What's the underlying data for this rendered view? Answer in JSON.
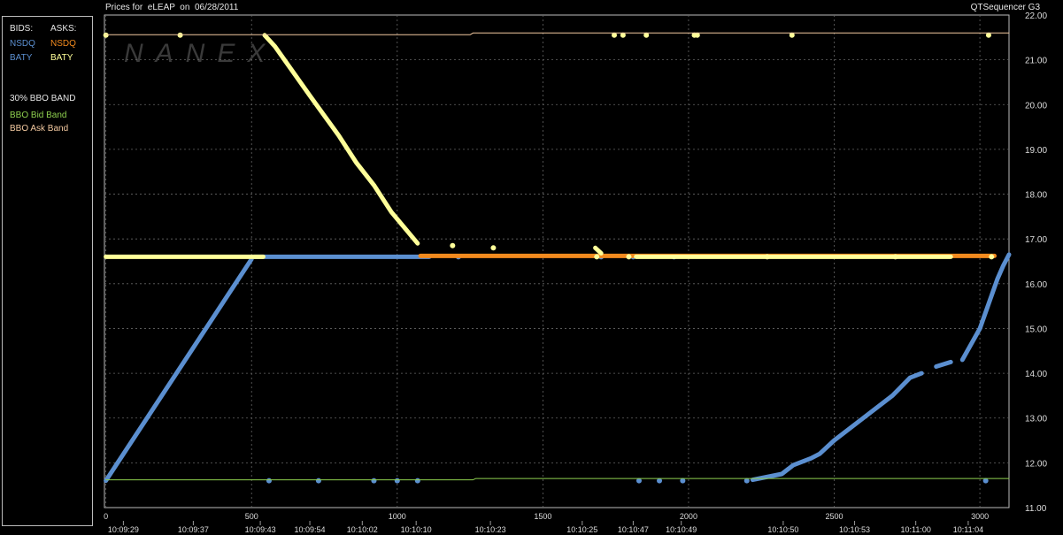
{
  "header": {
    "title": "Prices for  eLEAP  on  06/28/2011",
    "app_name": "QTSequencer G3"
  },
  "legend": {
    "bids_label": "BIDS:",
    "asks_label": "ASKS:",
    "bid_exchanges": [
      {
        "label": "NSDQ",
        "color": "#5b8fd0"
      },
      {
        "label": "BATY",
        "color": "#5b8fd0"
      }
    ],
    "ask_exchanges": [
      {
        "label": "NSDQ",
        "color": "#f28a1e"
      },
      {
        "label": "BATY",
        "color": "#ffff99"
      }
    ],
    "band_title": "30% BBO BAND",
    "bid_band": {
      "label": "BBO Bid Band",
      "color": "#8fd14f"
    },
    "ask_band": {
      "label": "BBO Ask Band",
      "color": "#f3c9a0"
    }
  },
  "watermark": "NANEX",
  "chart_data": {
    "type": "scatter",
    "xlim": [
      -5,
      3100
    ],
    "ylim": [
      11,
      22
    ],
    "y_ticks": [
      "11.00",
      "12.00",
      "13.00",
      "14.00",
      "15.00",
      "16.00",
      "17.00",
      "18.00",
      "19.00",
      "20.00",
      "21.00",
      "22.00"
    ],
    "x_ticks": [
      {
        "v": 0,
        "label": "0"
      },
      {
        "v": 500,
        "label": "500"
      },
      {
        "v": 1000,
        "label": "1000"
      },
      {
        "v": 1500,
        "label": "1500"
      },
      {
        "v": 2000,
        "label": "2000"
      },
      {
        "v": 2500,
        "label": "2500"
      },
      {
        "v": 3000,
        "label": "3000"
      }
    ],
    "time_labels": [
      {
        "v": 60,
        "label": "10:09:29"
      },
      {
        "v": 300,
        "label": "10:09:37"
      },
      {
        "v": 530,
        "label": "10:09:43"
      },
      {
        "v": 700,
        "label": "10:09:54"
      },
      {
        "v": 880,
        "label": "10:10:02"
      },
      {
        "v": 1065,
        "label": "10:10:10"
      },
      {
        "v": 1320,
        "label": "10:10:23"
      },
      {
        "v": 1635,
        "label": "10:10:25"
      },
      {
        "v": 1810,
        "label": "10:10:47"
      },
      {
        "v": 1975,
        "label": "10:10:49"
      },
      {
        "v": 2325,
        "label": "10:10:50"
      },
      {
        "v": 2570,
        "label": "10:10:53"
      },
      {
        "v": 2780,
        "label": "10:11:00"
      },
      {
        "v": 2960,
        "label": "10:11:04"
      }
    ],
    "grid": "dashed vertical and horizontal",
    "series": [
      {
        "name": "NSDQ",
        "role": "bid",
        "color": "#5b8fd0",
        "segments": [
          [
            [
              0,
              11.6
            ],
            [
              500,
              16.55
            ]
          ],
          [
            [
              510,
              16.6
            ],
            [
              1110,
              16.6
            ]
          ],
          [
            [
              2220,
              11.62
            ],
            [
              2320,
              11.75
            ],
            [
              2360,
              11.95
            ],
            [
              2420,
              12.1
            ],
            [
              2450,
              12.2
            ],
            [
              2500,
              12.5
            ],
            [
              2600,
              13.0
            ],
            [
              2700,
              13.5
            ],
            [
              2760,
              13.9
            ],
            [
              2800,
              14.0
            ]
          ],
          [
            [
              2850,
              14.15
            ],
            [
              2900,
              14.25
            ]
          ],
          [
            [
              2940,
              14.3
            ],
            [
              3000,
              15.0
            ],
            [
              3060,
              16.1
            ],
            [
              3080,
              16.4
            ],
            [
              3100,
              16.65
            ]
          ]
        ],
        "points": [
          [
            560,
            11.6
          ],
          [
            730,
            11.6
          ],
          [
            920,
            11.6
          ],
          [
            1000,
            11.6
          ],
          [
            1070,
            11.6
          ],
          [
            1830,
            11.6
          ],
          [
            1900,
            11.6
          ],
          [
            1980,
            11.6
          ],
          [
            2200,
            11.6
          ],
          [
            3020,
            11.6
          ],
          [
            1210,
            16.6
          ],
          [
            1700,
            16.6
          ],
          [
            1810,
            16.6
          ],
          [
            1950,
            16.6
          ]
        ]
      },
      {
        "name": "NSDQ",
        "role": "ask",
        "color": "#f28a1e",
        "segments": [
          [
            [
              1080,
              16.62
            ],
            [
              3050,
              16.62
            ]
          ]
        ],
        "points": []
      },
      {
        "name": "BATY",
        "role": "ask",
        "color": "#ffff99",
        "segments": [
          [
            [
              0,
              16.6
            ],
            [
              540,
              16.6
            ]
          ],
          [
            [
              545,
              21.55
            ],
            [
              580,
              21.3
            ],
            [
              700,
              20.2
            ],
            [
              800,
              19.3
            ],
            [
              860,
              18.7
            ],
            [
              920,
              18.2
            ],
            [
              980,
              17.6
            ],
            [
              1070,
              16.9
            ]
          ],
          [
            [
              1680,
              16.8
            ],
            [
              1700,
              16.68
            ]
          ],
          [
            [
              1820,
              16.6
            ],
            [
              2900,
              16.6
            ]
          ]
        ],
        "points": [
          [
            0,
            21.55
          ],
          [
            255,
            21.55
          ],
          [
            1190,
            16.85
          ],
          [
            1330,
            16.8
          ],
          [
            1745,
            21.55
          ],
          [
            1775,
            21.55
          ],
          [
            1855,
            21.55
          ],
          [
            2020,
            21.55
          ],
          [
            2030,
            21.55
          ],
          [
            2355,
            21.55
          ],
          [
            3030,
            21.55
          ],
          [
            1685,
            16.6
          ],
          [
            1795,
            16.6
          ],
          [
            2270,
            16.6
          ],
          [
            2710,
            16.6
          ],
          [
            3040,
            16.6
          ]
        ]
      },
      {
        "name": "BBO Ask Band",
        "role": "band",
        "color": "#f3c9a0",
        "segments": [
          [
            [
              0,
              21.56
            ],
            [
              1250,
              21.56
            ],
            [
              1260,
              21.6
            ],
            [
              3100,
              21.6
            ]
          ]
        ],
        "points": []
      },
      {
        "name": "BBO Bid Band",
        "role": "band",
        "color": "#8fd14f",
        "segments": [
          [
            [
              0,
              11.62
            ],
            [
              1260,
              11.62
            ],
            [
              1270,
              11.65
            ],
            [
              3100,
              11.65
            ]
          ]
        ],
        "points": []
      }
    ]
  }
}
